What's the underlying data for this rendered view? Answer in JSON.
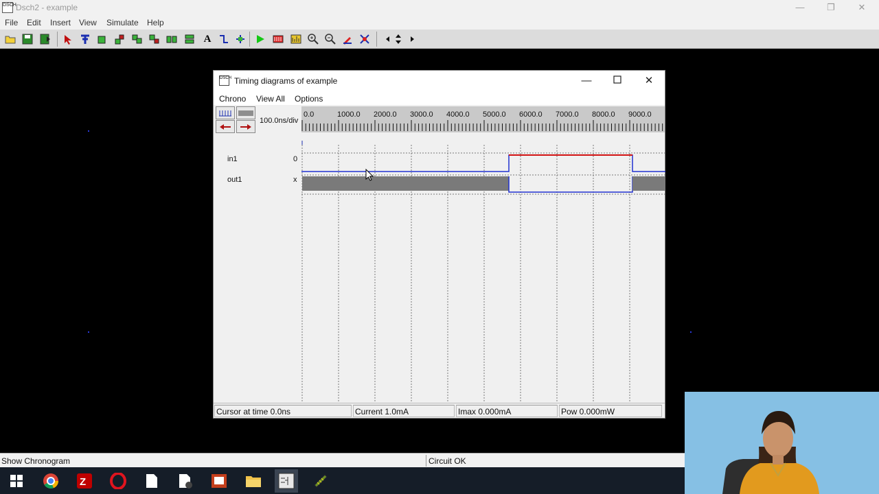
{
  "app": {
    "title": "Dsch2 - example",
    "icon_text": "DSCH"
  },
  "window_controls": {
    "minimize": "—",
    "restore": "❐",
    "close": "✕"
  },
  "menu": [
    "File",
    "Edit",
    "Insert",
    "View",
    "Simulate",
    "Help"
  ],
  "toolbar_icons": [
    "open-folder-icon",
    "save-icon",
    "save-as-icon",
    "select-arrow-icon",
    "wire-icon",
    "component-icon",
    "move-icon",
    "copy-icon",
    "rotate-icon",
    "flip-icon",
    "duplicate-icon",
    "text-icon",
    "connect-icon",
    "contact-icon",
    "simulate-play-icon",
    "timing-icon",
    "chart-icon",
    "zoom-in-icon",
    "zoom-out-icon",
    "edit-icon",
    "route-icon",
    "scroll-arrows-icon"
  ],
  "timing_window": {
    "title": "Timing diagrams of example",
    "menu": [
      "Chrono",
      "View All",
      "Options"
    ],
    "div_label": "100.0ns/div",
    "ruler_labels": [
      "0.0",
      "1000.0",
      "2000.0",
      "3000.0",
      "4000.0",
      "5000.0",
      "6000.0",
      "7000.0",
      "8000.0",
      "9000.0"
    ],
    "signals": [
      {
        "name": "in1",
        "value": "0"
      },
      {
        "name": "out1",
        "value": "x"
      }
    ],
    "status": {
      "cursor": "Cursor at time  0.0ns",
      "current": "Current  1.0mA",
      "imax": "Imax 0.000mA",
      "pow": "Pow 0.000mW"
    }
  },
  "statusbar": {
    "left": "Show Chronogram",
    "right": "Circuit OK"
  },
  "taskbar_icons": [
    "windows-start-icon",
    "chrome-icon",
    "filezilla-icon",
    "opera-icon",
    "file-icon",
    "document-icon",
    "presentation-icon",
    "file-explorer-icon",
    "dsch-app-icon",
    "microwind-icon"
  ]
}
